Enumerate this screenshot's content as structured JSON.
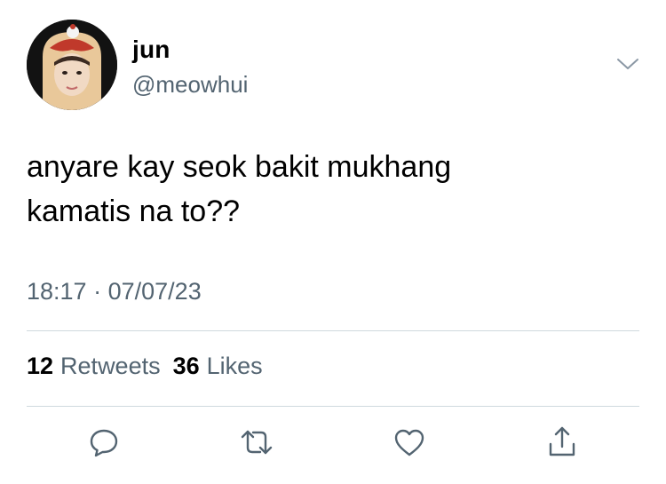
{
  "user": {
    "display_name": "jun",
    "handle": "@meowhui",
    "avatar_icon": "avatar-photo"
  },
  "tweet": {
    "text_line1": "anyare kay seok bakit mukhang",
    "text_line2": "kamatis na to??",
    "time": "18:17",
    "separator": "·",
    "date": "07/07/23"
  },
  "stats": {
    "retweets_count": "12",
    "retweets_label": "Retweets",
    "likes_count": "36",
    "likes_label": "Likes"
  },
  "icons": {
    "more": "chevron-down-icon",
    "reply": "reply-icon",
    "retweet": "retweet-icon",
    "like": "heart-icon",
    "share": "share-icon"
  },
  "colors": {
    "secondary_text": "#536471",
    "divider": "#cfd9de",
    "icon": "#536471"
  }
}
